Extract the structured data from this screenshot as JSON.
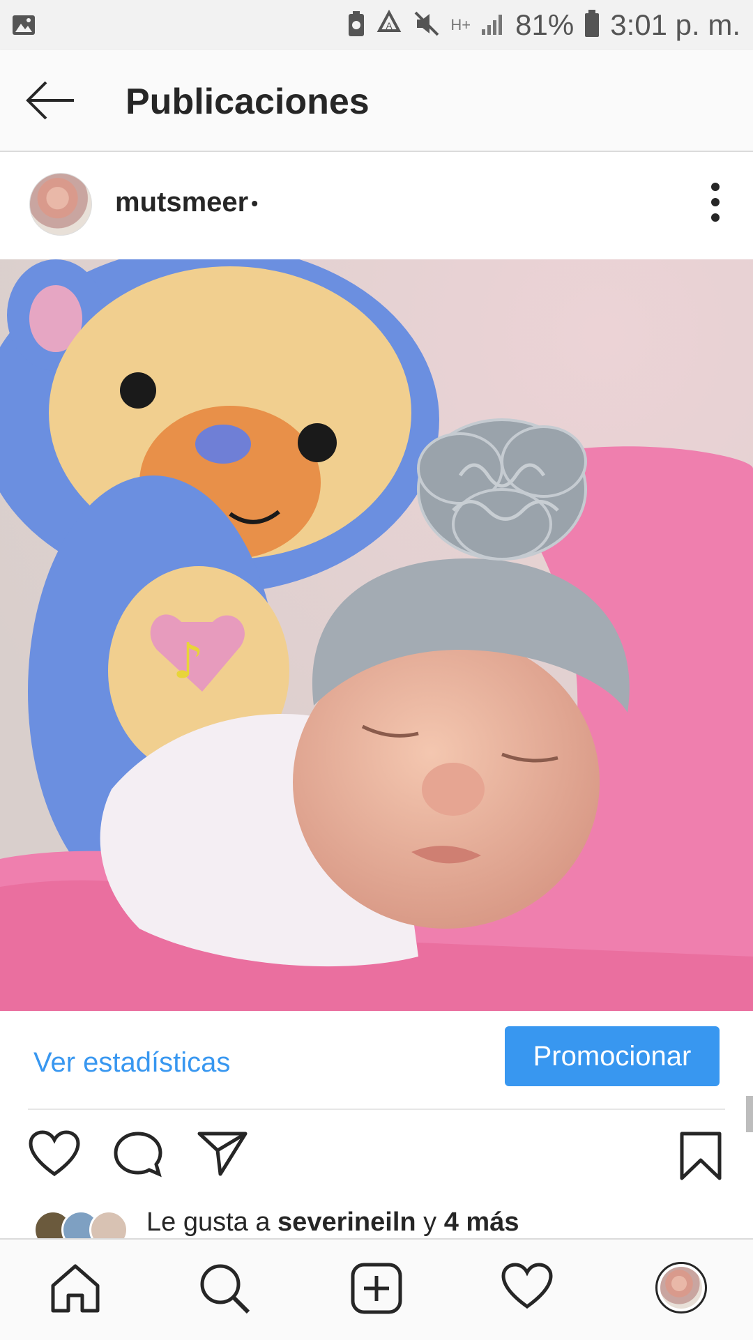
{
  "status_bar": {
    "battery_percent": "81%",
    "time": "3:01 p. m.",
    "network": "H+",
    "icons": [
      "gallery-icon",
      "battery-saver-icon",
      "recycle-icon",
      "mute-icon",
      "network-icon",
      "signal-icon",
      "battery-icon"
    ]
  },
  "app_bar": {
    "back_icon": "arrow-left-icon",
    "title": "Publicaciones"
  },
  "post": {
    "username": "mutsmeer",
    "separator": "•",
    "more_icon": "more-vertical-icon",
    "photo_description_icon": "photo",
    "insights_link": "Ver estadísticas",
    "promote_button": "Promocionar",
    "likes": {
      "prefix": "Le gusta a ",
      "user": "severineiln",
      "middle": " y ",
      "others": "4 más"
    }
  },
  "actions": [
    "heart-icon",
    "comment-icon",
    "share-icon",
    "bookmark-icon"
  ],
  "bottom_nav": [
    "home-icon",
    "search-icon",
    "add-post-icon",
    "activity-icon",
    "profile-avatar"
  ],
  "colors": {
    "accent": "#3897f0",
    "text": "#262626",
    "bar_bg": "#fafafa"
  }
}
